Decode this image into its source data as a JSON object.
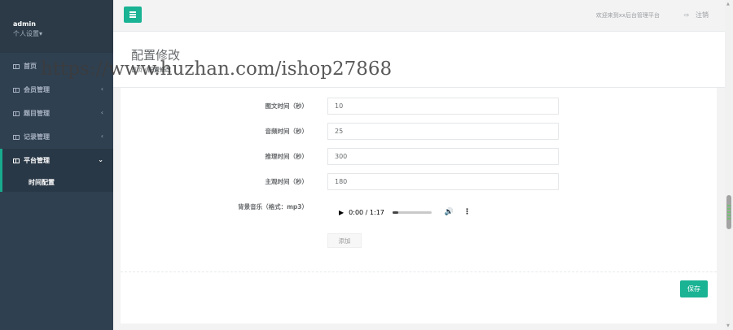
{
  "sidebar": {
    "user": {
      "name": "admin",
      "settings": "个人设置▾"
    },
    "items": [
      {
        "label": "首页",
        "arrow": ""
      },
      {
        "label": "会员管理",
        "arrow": "‹"
      },
      {
        "label": "题目管理",
        "arrow": "‹"
      },
      {
        "label": "记录管理",
        "arrow": "‹"
      },
      {
        "label": "平台管理",
        "arrow": "⌄"
      }
    ],
    "subitems": [
      {
        "label": "时间配置"
      }
    ]
  },
  "topbar": {
    "welcome": "欢迎来到xx后台管理平台",
    "logout_icon": "⇨",
    "logout": "注销"
  },
  "heading": {
    "title": "配置修改",
    "breadcrumb_home": "首页",
    "breadcrumb_current": "配置修改"
  },
  "watermark": "https://www.huzhan.com/ishop27868",
  "form": {
    "fields": [
      {
        "label": "图文时间（秒）",
        "value": "10"
      },
      {
        "label": "音频时间（秒）",
        "value": "25"
      },
      {
        "label": "推理时间（秒）",
        "value": "300"
      },
      {
        "label": "主观时间（秒）",
        "value": "180"
      }
    ],
    "music": {
      "label": "背景音乐（格式：mp3）",
      "play_icon": "▶",
      "time": "0:00 / 1:17",
      "volume_icon": "🔊",
      "more_icon": "⋮",
      "progress": 0.15
    },
    "add_label": "添加",
    "save_label": "保存"
  },
  "colors": {
    "accent": "#1ab394",
    "sidebar_bg": "#2f4050"
  }
}
